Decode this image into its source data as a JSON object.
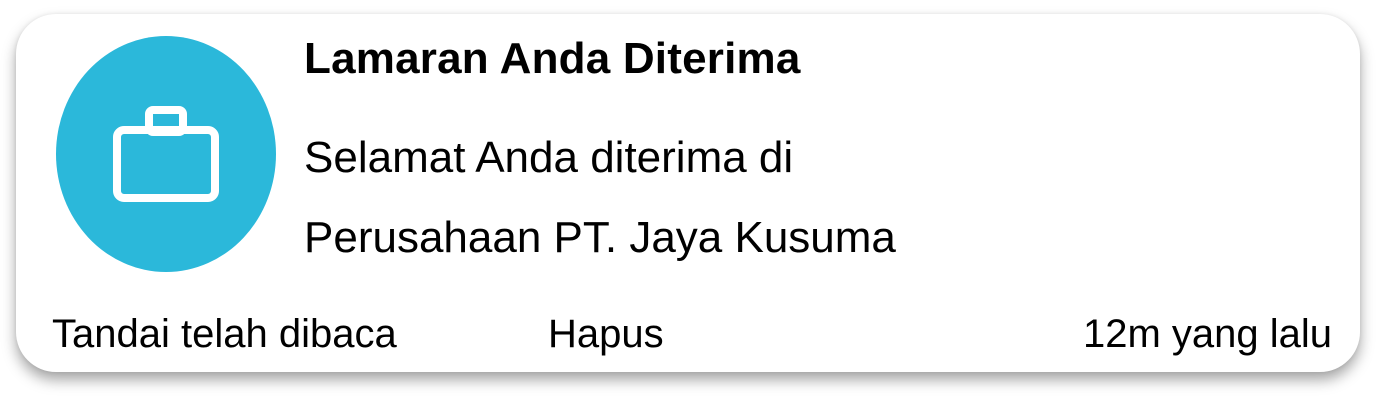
{
  "notification": {
    "icon": "briefcase-icon",
    "icon_color": "#2bb8da",
    "title": "Lamaran Anda Diterima",
    "message_lines": [
      "Selamat Anda diterima di",
      "Perusahaan PT. Jaya Kusuma"
    ],
    "actions": {
      "mark_read_label": "Tandai telah dibaca",
      "delete_label": "Hapus"
    },
    "timestamp": "12m yang lalu"
  }
}
